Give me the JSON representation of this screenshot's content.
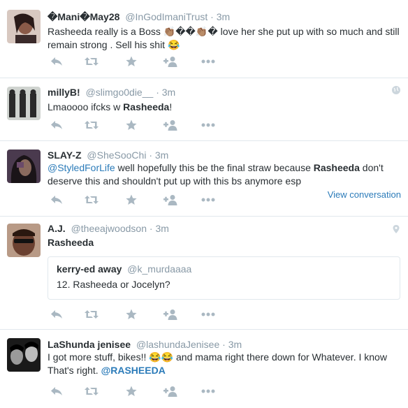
{
  "tweets": [
    {
      "name": "�Mani�May28",
      "handle": "@InGodImaniTrust",
      "sep": "·",
      "time": "3m",
      "text_parts": [
        "Rasheeda really is a Boss ",
        "👏🏽��👏🏽�",
        " love her she put up with so much and still remain strong  . Sell his shit ",
        "😂"
      ],
      "avatar_color": "#6b4a3e"
    },
    {
      "name": "millyB!",
      "handle": "@slimgo0die__",
      "sep": "·",
      "time": "3m",
      "text_prefix": "Lmaoooo ifcks w ",
      "text_bold": "Rasheeda",
      "text_suffix": "!",
      "corner_icon": "globe-icon",
      "avatar_color": "#8a8f8a"
    },
    {
      "name": "SLAY-Z",
      "handle": "@SheSooChi",
      "sep": "·",
      "time": "3m",
      "mention": "@StyledForLife",
      "text_mid": " well hopefully this be the final straw because ",
      "text_bold": "Rasheeda",
      "text_end": " don't deserve this and shouldn't put up with this bs anymore esp",
      "view_conversation": "View conversation",
      "avatar_color": "#3a2a3a"
    },
    {
      "name": "A.J.",
      "handle": "@theeajwoodson",
      "sep": "·",
      "time": "3m",
      "text_bold": "Rasheeda",
      "corner_icon": "location-pin-icon",
      "quote": {
        "name": "kerry-ed away",
        "handle": "@k_murdaaaa",
        "text": "12. Rasheeda or Jocelyn?"
      },
      "avatar_color": "#5a3a2a"
    },
    {
      "name": "LaShunda jenisee",
      "handle": "@lashundaJenisee",
      "sep": "·",
      "time": "3m",
      "text_line1_a": "I got more stuff, bikes!!  ",
      "emoji": "😂😂",
      "text_line1_b": " and mama right there down for Whatever.  I know That's right.  ",
      "mention": "@RASHEEDA",
      "avatar_color": "#2a2a2a"
    }
  ],
  "colors": {
    "accent": "#2b7bb9",
    "muted": "#8899a6",
    "icon": "#aab8c2",
    "divider": "#e1e8ed"
  }
}
